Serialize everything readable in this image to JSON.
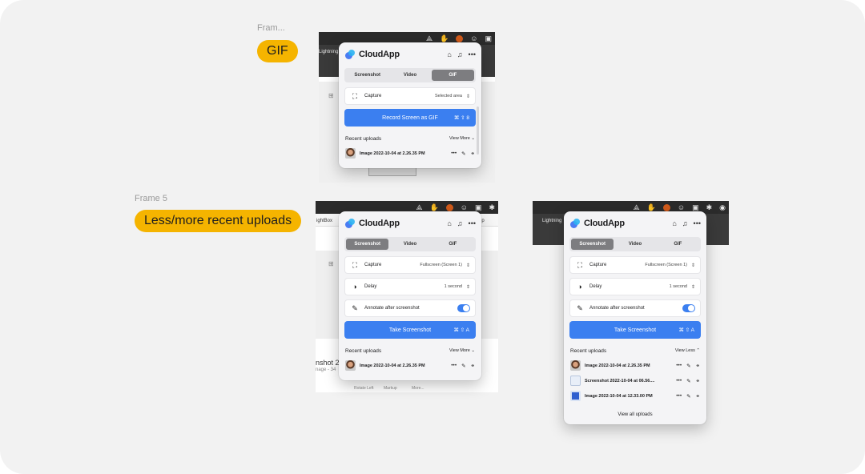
{
  "frames": [
    {
      "label": "Fram...",
      "pill": "GIF"
    },
    {
      "label": "Frame 5",
      "pill": "Less/more recent uploads"
    }
  ],
  "backdrop": {
    "lightning_1": "Lightning C",
    "lightning_2": "Lightning",
    "lightbox": "ightBox",
    "app_p": "pp",
    "screenshot_partial": "nshot 20",
    "image_partial": "nage - 34",
    "rotate_left": "Rotate Left",
    "markup": "Markup",
    "more": "More..."
  },
  "popup_gif": {
    "brand": "CloudApp",
    "tabs": [
      "Screenshot",
      "Video",
      "GIF"
    ],
    "active_tab": "GIF",
    "capture_label": "Capture",
    "capture_value": "Selected area",
    "cta_label": "Record Screen as GIF",
    "cta_shortcut": "⌘ ⇧ 8",
    "recent_title": "Recent uploads",
    "view_toggle": "View More ⌄",
    "uploads": [
      {
        "name": "Image 2022-10-04 at 2.26.35 PM",
        "thumb": "face"
      }
    ]
  },
  "popup_more": {
    "brand": "CloudApp",
    "tabs": [
      "Screenshot",
      "Video",
      "GIF"
    ],
    "active_tab": "Screenshot",
    "capture_label": "Capture",
    "capture_value": "Fullscreen (Screen 1)",
    "delay_label": "Delay",
    "delay_value": "1 second",
    "annotate_label": "Annotate after screenshot",
    "annotate_on": true,
    "cta_label": "Take Screenshot",
    "cta_shortcut": "⌘ ⇧ A",
    "recent_title": "Recent uploads",
    "view_toggle": "View More ⌄",
    "uploads": [
      {
        "name": "Image 2022-10-04 at 2.26.35 PM",
        "thumb": "face"
      }
    ]
  },
  "popup_less": {
    "brand": "CloudApp",
    "tabs": [
      "Screenshot",
      "Video",
      "GIF"
    ],
    "active_tab": "Screenshot",
    "capture_label": "Capture",
    "capture_value": "Fullscreen (Screen 1)",
    "delay_label": "Delay",
    "delay_value": "1 second",
    "annotate_label": "Annotate after screenshot",
    "annotate_on": true,
    "cta_label": "Take Screenshot",
    "cta_shortcut": "⌘ ⇧ A",
    "recent_title": "Recent uploads",
    "view_toggle": "View Less ⌃",
    "uploads": [
      {
        "name": "Image 2022-10-04 at 2.26.35 PM",
        "thumb": "face"
      },
      {
        "name": "Screenshot 2022-10-04 at 06.56....",
        "thumb": "doc"
      },
      {
        "name": "Image 2022-10-04 at 12.33.00 PM",
        "thumb": "phone"
      }
    ],
    "view_all": "View all uploads"
  },
  "icons": {
    "capture": "crop-frame-icon",
    "delay": "half-circle-icon",
    "annotate": "pen-icon",
    "home": "home-icon",
    "bell": "bell-icon",
    "more": "more-icon",
    "link": "link-icon"
  },
  "colors": {
    "accent_blue": "#3b7ff0",
    "pill_yellow": "#f5b400",
    "active_tab": "#7d7d80"
  }
}
